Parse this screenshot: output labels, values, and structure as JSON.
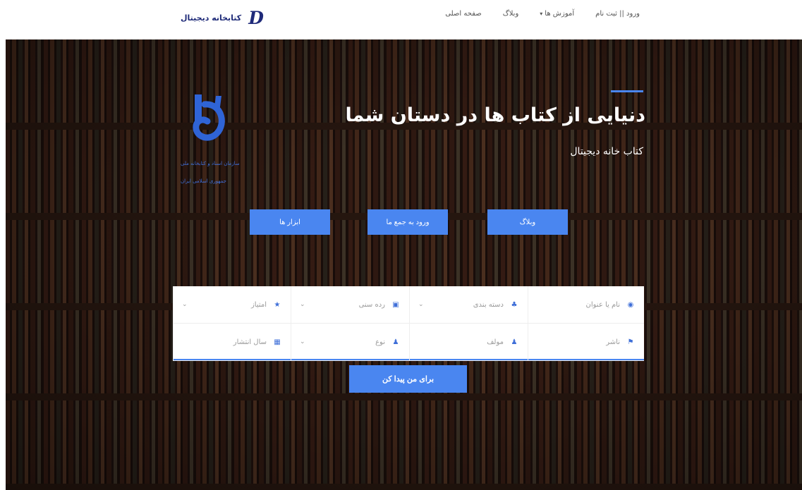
{
  "brand": {
    "mark": "D",
    "name": "کتابخانه دیجیتال"
  },
  "nav": {
    "items": [
      {
        "label": "صفحه اصلی"
      },
      {
        "label": "وبلاگ"
      },
      {
        "label": "آموزش ها",
        "caret": "▾"
      },
      {
        "label": "ورود || ثبت نام"
      }
    ]
  },
  "hero": {
    "title": "دنیایی از کتاب ها در دستان شما",
    "subtitle": "کتاب خانه دیجیتال"
  },
  "logo": {
    "line1": "سازمان اسناد و کتابخانه ملی",
    "line2": "جمهوری اسلامی ایران"
  },
  "actions": {
    "blog": "وبلاگ",
    "join": "ورود به جمع ما",
    "tools": "ابزار ها"
  },
  "search": {
    "title_field": "نام یا عنوان",
    "category_field": "دسته بندی",
    "age_field": "رده سنی",
    "rating_field": "امتیاز",
    "publisher_field": "ناشر",
    "author_field": "مولف",
    "type_field": "نوع",
    "year_field": "سال انتشار",
    "submit": "برای من پیدا کن"
  },
  "colors": {
    "accent": "#4a86f0",
    "brand_dark": "#1e2a78"
  },
  "icons": {
    "title": "search-icon",
    "category": "category-icon",
    "age": "age-icon",
    "rating": "star-icon",
    "publisher": "publisher-icon",
    "author": "author-icon",
    "type": "type-icon",
    "year": "calendar-icon",
    "chevron": "chevron-down-icon"
  }
}
